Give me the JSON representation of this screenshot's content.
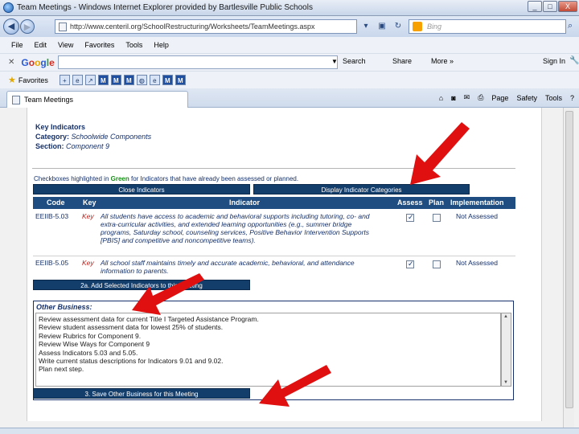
{
  "window": {
    "title": "Team Meetings - Windows Internet Explorer provided by Bartlesville Public Schools",
    "controls": [
      "_",
      "□",
      "X"
    ]
  },
  "address_bar": {
    "url": "http://www.centeril.org/SchoolRestructuring/Worksheets/TeamMeetings.aspx",
    "search_placeholder": "Bing"
  },
  "menu": [
    "File",
    "Edit",
    "View",
    "Favorites",
    "Tools",
    "Help"
  ],
  "google_toolbar": {
    "logo": "Google",
    "search_label": "Search",
    "share_label": "Share",
    "more_label": "More »",
    "signin_label": "Sign In"
  },
  "favorites_bar": {
    "label": "Favorites"
  },
  "tab": {
    "label": "Team Meetings"
  },
  "command_bar": {
    "page": "Page",
    "safety": "Safety",
    "tools": "Tools",
    "help": "?"
  },
  "key_indicators": {
    "heading": "Key Indicators",
    "category_label": "Category:",
    "category_value": "Schoolwide Components",
    "section_label": "Section:",
    "section_value": "Component 9"
  },
  "note": {
    "prefix": "Checkboxes highlighted in ",
    "green_word": "Green",
    "suffix": " for Indicators that have already been assessed or planned."
  },
  "buttons": {
    "close_indicators": "Close Indicators",
    "display_categories": "Display Indicator Categories",
    "add_selected": "2a. Add Selected Indicators to this Meeting",
    "save_other": "3. Save Other Business for this Meeting"
  },
  "table": {
    "headers": {
      "code": "Code",
      "key": "Key",
      "indicator": "Indicator",
      "assess": "Assess",
      "plan": "Plan",
      "implementation": "Implementation"
    },
    "rows": [
      {
        "code": "EEIIB-5.03",
        "key": "Key",
        "indicator": "All students have access to academic and behavioral supports including tutoring, co- and extra-curricular activities, and extended learning opportunities (e.g., summer bridge programs, Saturday school, counseling services, Positive Behavior Intervention Supports [PBIS] and competitive and noncompetitive teams).",
        "assess": true,
        "plan": false,
        "implementation": "Not Assessed"
      },
      {
        "code": "EEIIB-5.05",
        "key": "Key",
        "indicator": "All school staff maintains timely and accurate academic, behavioral, and attendance information to parents.",
        "assess": true,
        "plan": false,
        "implementation": "Not Assessed"
      }
    ]
  },
  "other_business": {
    "title": "Other Business:",
    "lines": [
      "Review assessment data for current Title I Targeted Assistance Program.",
      "Review student assessment data for lowest 25% of students.",
      "Review Rubrics for Component 9.",
      "Review Wise Ways for Component 9",
      "Assess Indicators 5.03 and 5.05.",
      "Write current status descriptions for Indicators 9.01 and 9.02.",
      "Plan next step."
    ]
  },
  "colors": {
    "annotation_arrow": "#e01010",
    "header_bg": "#1f4d82",
    "button_bg": "#133d6b"
  }
}
